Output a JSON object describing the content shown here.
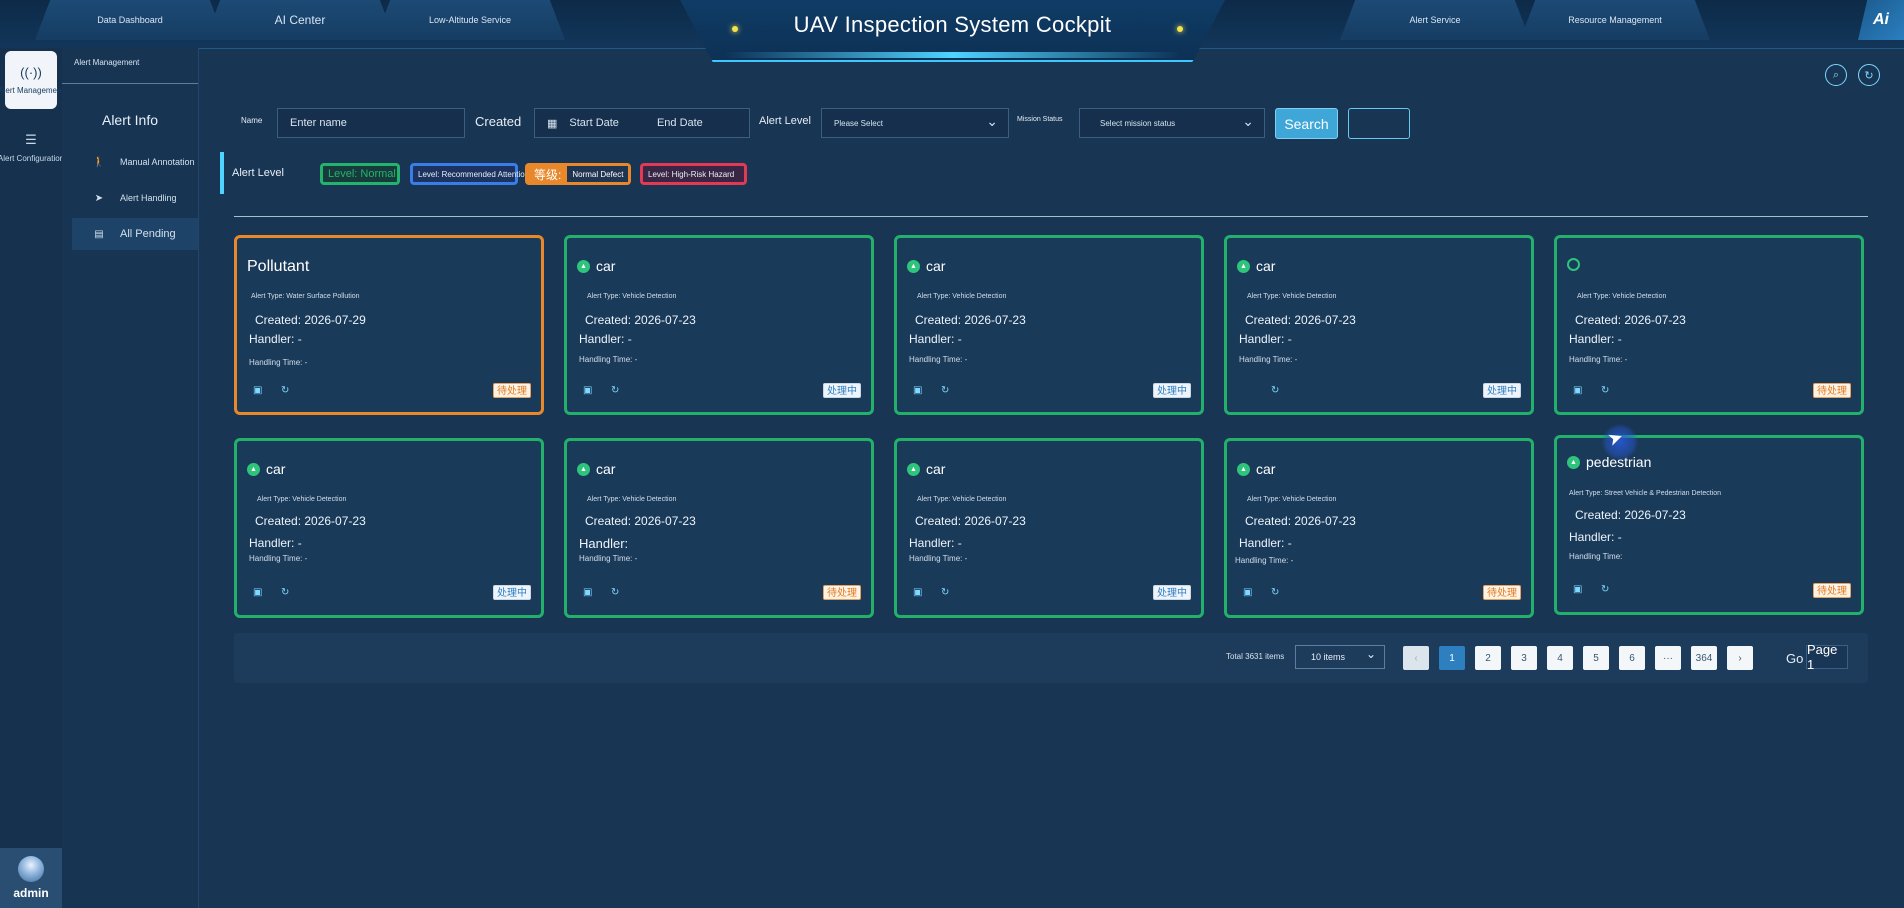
{
  "header": {
    "title": "UAV Inspection System Cockpit",
    "tabs": [
      "Data Dashboard",
      "AI Center",
      "Low-Altitude Service",
      "Alert Service",
      "Resource Management"
    ],
    "logo": "Ai"
  },
  "rail": {
    "items": [
      {
        "label": "Alert Management",
        "icon": "signal-icon"
      },
      {
        "label": "Alert Configuration",
        "icon": "list-icon"
      }
    ],
    "user": "admin"
  },
  "subnav": {
    "header": "Alert Management",
    "title": "Alert Info",
    "items": [
      {
        "label": "Manual Annotation",
        "icon": "person-icon"
      },
      {
        "label": "Alert Handling",
        "icon": "send-icon"
      },
      {
        "label": "All Pending",
        "icon": "document-icon"
      }
    ]
  },
  "filters": {
    "name_label": "Name",
    "name_placeholder": "Enter name",
    "created_label": "Created",
    "start_date": "Start Date",
    "end_date": "End Date",
    "level_label": "Alert Level",
    "level_placeholder": "Please Select",
    "mission_label": "Mission Status",
    "mission_placeholder": "Select mission status",
    "search": "Search",
    "reset": ""
  },
  "levels": {
    "label": "Alert Level",
    "green": "Level: Normal",
    "blue": "Level: Recommended Attention",
    "orange_prefix": "等级:",
    "orange": "Normal Defect",
    "red": "Level: High-Risk Hazard"
  },
  "cards": [
    {
      "title": "Pollutant",
      "type": "Alert Type: Water Surface Pollution",
      "created": "Created: 2026-07-29",
      "handler": "Handler: -",
      "time": "Handling Time: -",
      "status": "待处理",
      "level": "orange"
    },
    {
      "title": "car",
      "type": "Alert Type: Vehicle Detection",
      "created": "Created: 2026-07-23",
      "handler": "Handler: -",
      "time": "Handling Time: -",
      "status": "处理中",
      "level": "green"
    },
    {
      "title": "car",
      "type": "Alert Type: Vehicle Detection",
      "created": "Created: 2026-07-23",
      "handler": "Handler: -",
      "time": "Handling Time: -",
      "status": "处理中",
      "level": "green"
    },
    {
      "title": "car",
      "type": "Alert Type: Vehicle Detection",
      "created": "Created: 2026-07-23",
      "handler": "Handler: -",
      "time": "Handling Time: -",
      "status": "处理中",
      "level": "green"
    },
    {
      "title": "",
      "type": "Alert Type: Vehicle Detection",
      "created": "Created: 2026-07-23",
      "handler": "Handler: -",
      "time": "Handling Time: -",
      "status": "待处理",
      "level": "green"
    },
    {
      "title": "car",
      "type": "Alert Type: Vehicle Detection",
      "created": "Created: 2026-07-23",
      "handler": "Handler: -",
      "time": "Handling Time: -",
      "status": "处理中",
      "level": "green"
    },
    {
      "title": "car",
      "type": "Alert Type: Vehicle Detection",
      "created": "Created: 2026-07-23",
      "handler": "Handler:",
      "time": "Handling Time: -",
      "status": "待处理",
      "level": "green"
    },
    {
      "title": "car",
      "type": "Alert Type: Vehicle Detection",
      "created": "Created: 2026-07-23",
      "handler": "Handler: -",
      "time": "Handling Time: -",
      "status": "处理中",
      "level": "green"
    },
    {
      "title": "car",
      "type": "Alert Type: Vehicle Detection",
      "created": "Created: 2026-07-23",
      "handler": "Handler: -",
      "time": "Handling Time: -",
      "status": "待处理",
      "level": "green"
    },
    {
      "title": "pedestrian",
      "type": "Alert Type: Street Vehicle & Pedestrian Detection",
      "created": "Created: 2026-07-23",
      "handler": "Handler: -",
      "time": "Handling Time:",
      "status": "待处理",
      "level": "green"
    }
  ],
  "pagination": {
    "total": "Total 3631 items",
    "page_size": "10 items",
    "prev": "‹",
    "pages": [
      "1",
      "2",
      "3",
      "4",
      "5",
      "6",
      "···",
      "364"
    ],
    "next": "›",
    "goto": "Go",
    "goto_value": "Page 1"
  },
  "colors": {
    "accent": "#3fa6d8",
    "level_normal": "#22b06a",
    "level_attention": "#3a7de8",
    "level_defect": "#e9882b",
    "level_hazard": "#e23a55"
  }
}
